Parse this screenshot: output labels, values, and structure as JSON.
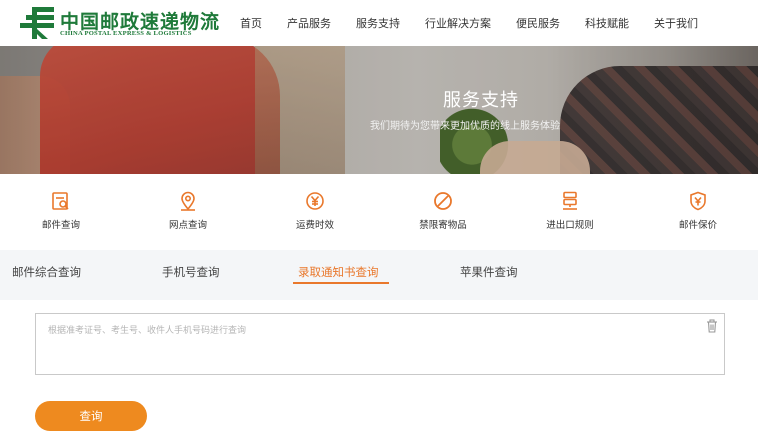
{
  "logo": {
    "name_cn": "中国邮政速递物流",
    "name_en": "CHINA POSTAL EXPRESS & LOGISTICS"
  },
  "nav": {
    "items": [
      "首页",
      "产品服务",
      "服务支持",
      "行业解决方案",
      "便民服务",
      "科技赋能",
      "关于我们"
    ]
  },
  "banner": {
    "title": "服务支持",
    "subtitle": "我们期待为您带来更加优质的线上服务体验"
  },
  "services": {
    "items": [
      {
        "label": "邮件查询",
        "icon": "mail-search-icon"
      },
      {
        "label": "网点查询",
        "icon": "location-pin-icon"
      },
      {
        "label": "运费时效",
        "icon": "yuan-coin-icon"
      },
      {
        "label": "禁限寄物品",
        "icon": "prohibited-icon"
      },
      {
        "label": "进出口规则",
        "icon": "customs-rule-icon"
      },
      {
        "label": "邮件保价",
        "icon": "shield-yuan-icon"
      }
    ]
  },
  "tabs": {
    "items": [
      "邮件综合查询",
      "手机号查询",
      "录取通知书查询",
      "苹果件查询"
    ],
    "active_index": 2
  },
  "query": {
    "placeholder": "根据准考证号、考生号、收件人手机号码进行查询",
    "value": "",
    "button_label": "查询"
  },
  "colors": {
    "brand_green": "#1f7a3a",
    "accent_orange": "#e9782c",
    "button_orange": "#ee8a1f"
  }
}
